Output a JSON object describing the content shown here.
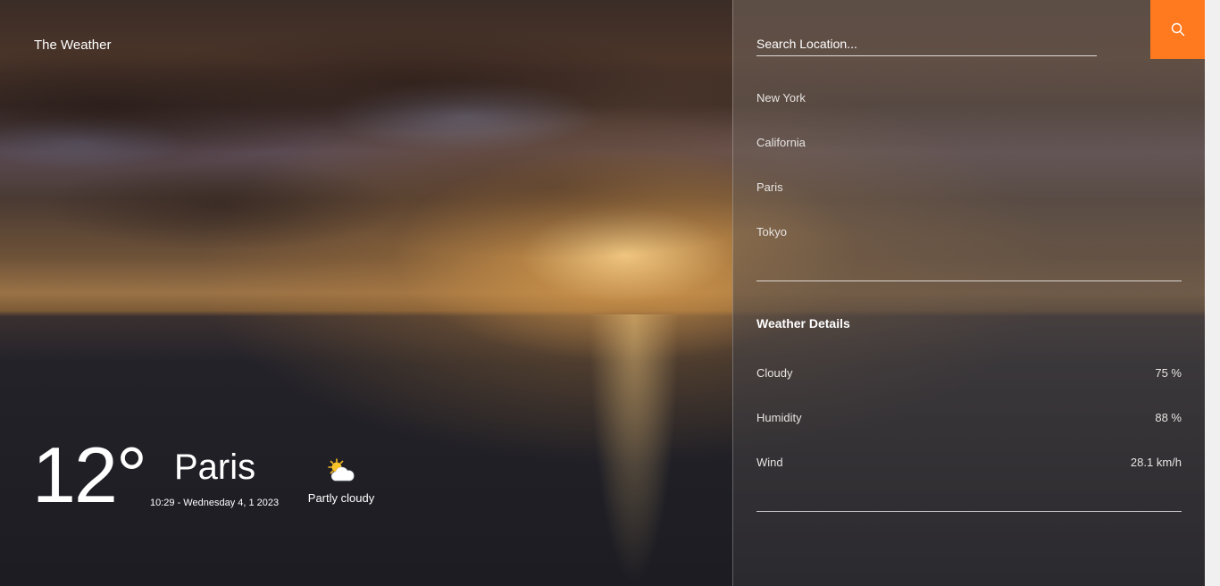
{
  "brand": {
    "title": "The Weather"
  },
  "current": {
    "temperature": "12°",
    "city": "Paris",
    "datetime": "10:29 - Wednesday 4, 1 2023",
    "condition": "Partly cloudy",
    "icon": "partly-cloudy-icon"
  },
  "search": {
    "placeholder": "Search Location...",
    "value": "",
    "button_icon": "search-icon",
    "button_color": "#ff7a1f"
  },
  "locations": [
    "New York",
    "California",
    "Paris",
    "Tokyo"
  ],
  "details": {
    "title": "Weather Details",
    "rows": [
      {
        "label": "Cloudy",
        "value": "75 %"
      },
      {
        "label": "Humidity",
        "value": "88 %"
      },
      {
        "label": "Wind",
        "value": "28.1 km/h"
      }
    ]
  }
}
